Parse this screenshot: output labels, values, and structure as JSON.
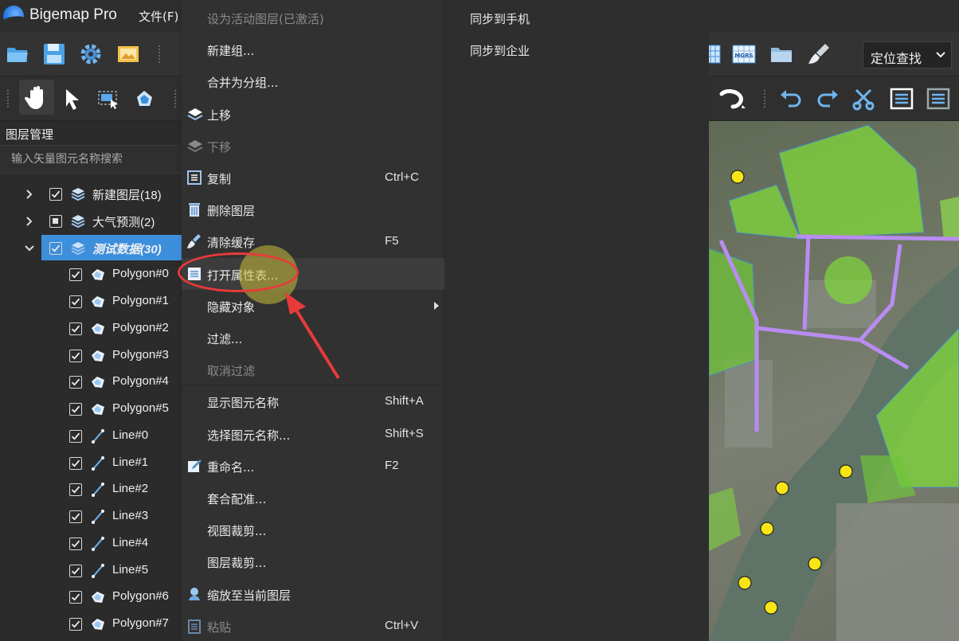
{
  "app": {
    "title": "Bigemap Pro",
    "menu_file": "文件(F)"
  },
  "toolbar": {
    "locate_label": "定位查找",
    "colors": {
      "toolbar_bg": "#333333",
      "accent": "#3d8fdc"
    },
    "row1_icons": [
      "folder-open-icon",
      "save-icon",
      "gear-icon",
      "image-icon",
      "grid-icon",
      "mgrs-icon",
      "folder-icon",
      "brush-icon"
    ],
    "row2_icons": [
      "hand-icon",
      "pointer-icon",
      "select-rect-icon",
      "edit-shape-icon",
      "lasso-icon",
      "undo-icon",
      "redo-icon",
      "scissors-icon",
      "list-icon"
    ]
  },
  "layer_panel": {
    "title": "图层管理",
    "search_placeholder": "输入矢量图元名称搜索",
    "rows": [
      {
        "label": "新建图层(18)",
        "type": "group",
        "expanded": false,
        "checked": "checked"
      },
      {
        "label": "大气预测(2)",
        "type": "group",
        "expanded": false,
        "checked": "partial"
      },
      {
        "label": "测试数据(30)",
        "type": "group",
        "expanded": true,
        "checked": "checked",
        "selected": true
      },
      {
        "label": "Polygon#0",
        "type": "polygon",
        "checked": "checked"
      },
      {
        "label": "Polygon#1",
        "type": "polygon",
        "checked": "checked"
      },
      {
        "label": "Polygon#2",
        "type": "polygon",
        "checked": "checked"
      },
      {
        "label": "Polygon#3",
        "type": "polygon",
        "checked": "checked"
      },
      {
        "label": "Polygon#4",
        "type": "polygon",
        "checked": "checked"
      },
      {
        "label": "Polygon#5",
        "type": "polygon",
        "checked": "checked"
      },
      {
        "label": "Line#0",
        "type": "line",
        "checked": "checked"
      },
      {
        "label": "Line#1",
        "type": "line",
        "checked": "checked"
      },
      {
        "label": "Line#2",
        "type": "line",
        "checked": "checked"
      },
      {
        "label": "Line#3",
        "type": "line",
        "checked": "checked"
      },
      {
        "label": "Line#4",
        "type": "line",
        "checked": "checked"
      },
      {
        "label": "Line#5",
        "type": "line",
        "checked": "checked"
      },
      {
        "label": "Polygon#6",
        "type": "polygon",
        "checked": "checked"
      },
      {
        "label": "Polygon#7",
        "type": "polygon",
        "checked": "checked"
      }
    ]
  },
  "context_menu": {
    "items": [
      {
        "label": "设为活动图层(已激活)",
        "disabled": true
      },
      {
        "label": "新建组..."
      },
      {
        "label": "合并为分组..."
      },
      {
        "label": "上移",
        "icon": "layers-up-icon"
      },
      {
        "label": "下移",
        "icon": "layers-down-icon",
        "disabled": true
      },
      {
        "label": "复制",
        "icon": "copy-icon",
        "shortcut": "Ctrl+C"
      },
      {
        "label": "删除图层",
        "icon": "trash-icon"
      },
      {
        "label": "清除缓存",
        "icon": "broom-icon",
        "shortcut": "F5"
      },
      {
        "label": "打开属性表...",
        "icon": "table-icon",
        "hover": true
      },
      {
        "label": "隐藏对象",
        "submenu": true
      },
      {
        "label": "过滤..."
      },
      {
        "label": "取消过滤",
        "disabled": true
      },
      {
        "label": "显示图元名称",
        "shortcut": "Shift+A",
        "separator_before": true
      },
      {
        "label": "选择图元名称...",
        "shortcut": "Shift+S"
      },
      {
        "label": "重命名...",
        "icon": "rename-icon",
        "shortcut": "F2"
      },
      {
        "label": "套合配准..."
      },
      {
        "label": "视图裁剪..."
      },
      {
        "label": "图层裁剪..."
      },
      {
        "label": "缩放至当前图层",
        "icon": "location-pin-icon"
      },
      {
        "label": "粘贴",
        "icon": "paste-icon",
        "shortcut": "Ctrl+V",
        "disabled": true
      }
    ],
    "submenu_items": [
      "同步到手机",
      "同步到企业"
    ]
  }
}
